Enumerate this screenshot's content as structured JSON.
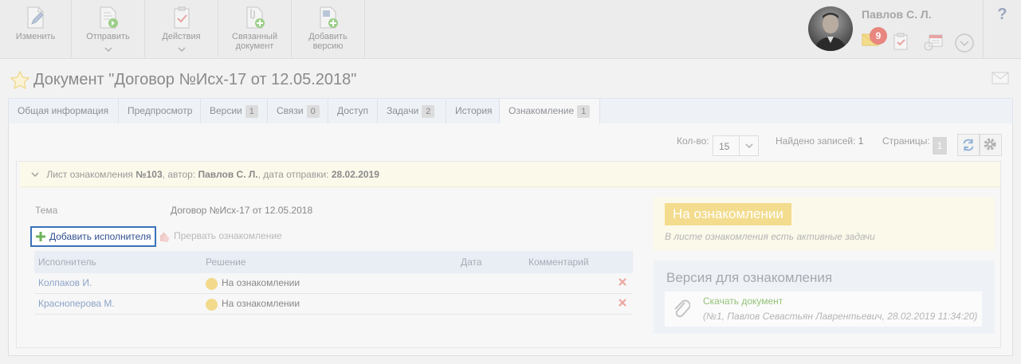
{
  "toolbar": {
    "edit": "Изменить",
    "send": "Отправить",
    "actions": "Действия",
    "related_doc": "Связанный\nдокумент",
    "add_version": "Добавить\nверсию"
  },
  "user": {
    "name": "Павлов С. Л.",
    "notification_count": "9"
  },
  "help_label": "?",
  "document": {
    "title": "Документ \"Договор №Исх-17 от 12.05.2018\""
  },
  "tabs": [
    {
      "label": "Общая информация",
      "count": ""
    },
    {
      "label": "Предпросмотр",
      "count": ""
    },
    {
      "label": "Версии",
      "count": "1"
    },
    {
      "label": "Связи",
      "count": "0"
    },
    {
      "label": "Доступ",
      "count": ""
    },
    {
      "label": "Задачи",
      "count": "2"
    },
    {
      "label": "История",
      "count": ""
    },
    {
      "label": "Ознакомление",
      "count": "1"
    }
  ],
  "pager": {
    "count_label": "Кол-во:",
    "count_value": "15",
    "found_label": "Найдено записей:",
    "found_value": "1",
    "pages_label": "Страницы:",
    "page_value": "1"
  },
  "sheet": {
    "prefix": "Лист ознакомления",
    "number": "№103",
    "author_label": ", автор:",
    "author": "Павлов С. Л.",
    "date_label": ", дата отправки:",
    "date": "28.02.2019"
  },
  "subject": {
    "label": "Тема",
    "value": "Договор №Исх-17 от 12.05.2018"
  },
  "actions": {
    "add_executor": "Добавить исполнителя",
    "interrupt": "Прервать ознакомление"
  },
  "grid": {
    "headers": {
      "executor": "Исполнитель",
      "decision": "Решение",
      "date": "Дата",
      "comment": "Комментарий"
    },
    "rows": [
      {
        "executor": "Колпаков И.",
        "decision": "На ознакомлении"
      },
      {
        "executor": "Красноперова М.",
        "decision": "На ознакомлении"
      }
    ]
  },
  "status": {
    "label": "На ознакомлении",
    "note": "В листе ознакомления есть активные задачи"
  },
  "version": {
    "title": "Версия для ознакомления",
    "download": "Скачать документ",
    "meta": "(№1, Павлов Севастьян Лаврентьевич, 28.02.2019 11:34:20)"
  },
  "colors": {
    "status_pill": "#f3dc8e",
    "link_green": "#92c27a",
    "focus_blue": "#3a72b8",
    "badge_red": "#e8867f"
  }
}
